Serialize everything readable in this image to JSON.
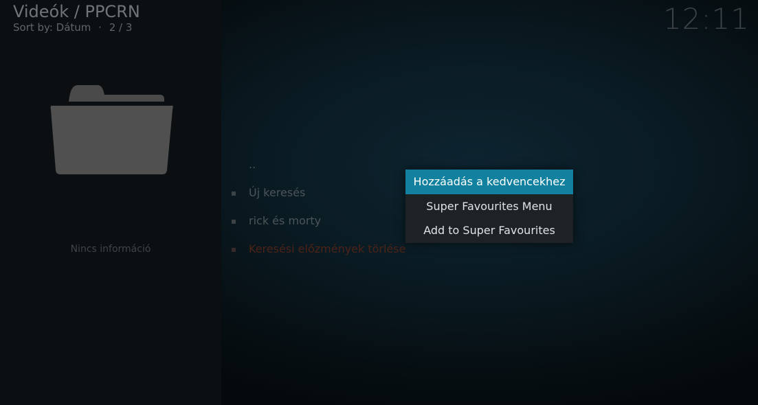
{
  "header": {
    "title": "Videók / PPCRN",
    "sort_label": "Sort by: Dátum",
    "separator": "·",
    "page_position": "2 / 3",
    "clock": "12:11"
  },
  "info_panel": {
    "thumbnail_icon": "folder-icon",
    "info_text": "Nincs információ"
  },
  "list": {
    "items": [
      {
        "label": "..",
        "bullet": false
      },
      {
        "label": "Új keresés",
        "bullet": true
      },
      {
        "label": "rick és morty",
        "bullet": true
      },
      {
        "label": "Keresési előzmények törlése",
        "bullet": true
      }
    ]
  },
  "context_menu": {
    "items": [
      {
        "label": "Hozzáadás a kedvencekhez",
        "selected": true
      },
      {
        "label": "Super Favourites Menu",
        "selected": false
      },
      {
        "label": "Add to Super Favourites",
        "selected": false
      }
    ]
  },
  "colors": {
    "accent": "#12809f",
    "menu_background": "#1d2225",
    "warning_text": "#4d2317"
  }
}
